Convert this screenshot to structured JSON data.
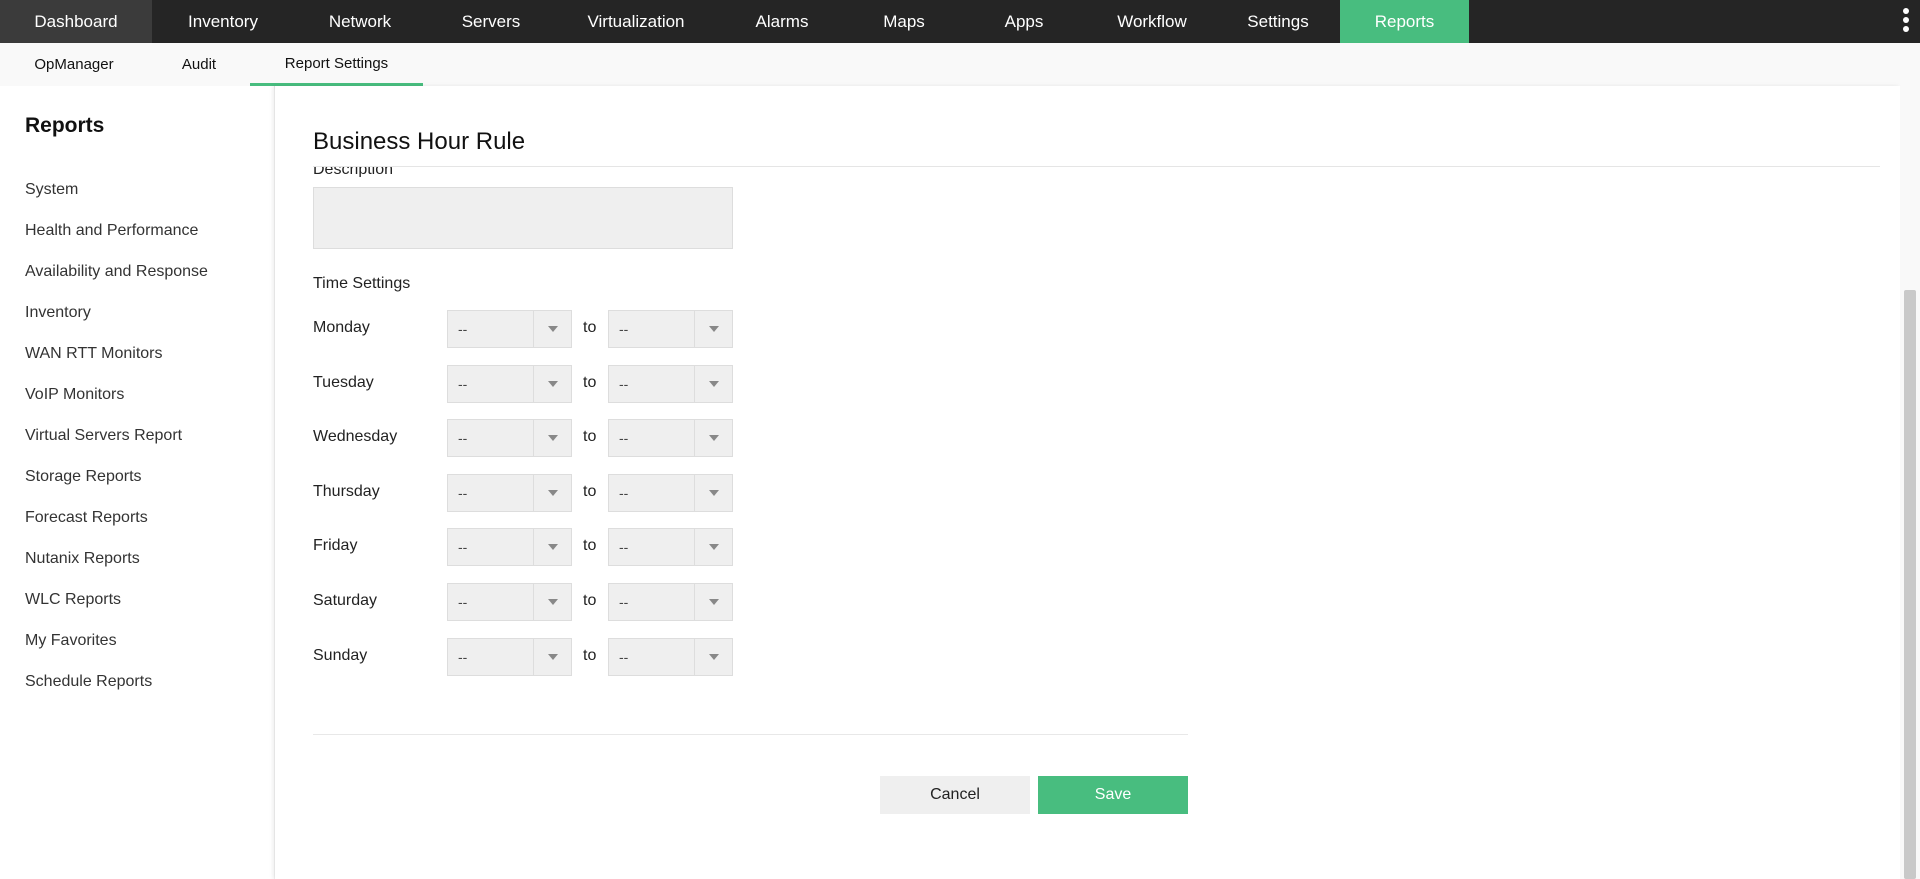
{
  "topnav": {
    "tabs": [
      "Dashboard",
      "Inventory",
      "Network",
      "Servers",
      "Virtualization",
      "Alarms",
      "Maps",
      "Apps",
      "Workflow",
      "Settings",
      "Reports"
    ],
    "active": "Reports",
    "accent": "#48bd7f"
  },
  "subnav": {
    "tabs": [
      "OpManager",
      "Audit",
      "Report Settings"
    ],
    "active": "Report Settings"
  },
  "sidebar": {
    "title": "Reports",
    "items": [
      "System",
      "Health and Performance",
      "Availability and Response",
      "Inventory",
      "WAN RTT Monitors",
      "VoIP Monitors",
      "Virtual Servers Report",
      "Storage Reports",
      "Forecast Reports",
      "Nutanix Reports",
      "WLC Reports",
      "My Favorites",
      "Schedule Reports"
    ]
  },
  "main": {
    "title": "Business Hour Rule",
    "description_label": "Description",
    "description_value": "",
    "time_settings_label": "Time Settings",
    "to_label": "to",
    "days": [
      {
        "day": "Monday",
        "from": "--",
        "to": "--"
      },
      {
        "day": "Tuesday",
        "from": "--",
        "to": "--"
      },
      {
        "day": "Wednesday",
        "from": "--",
        "to": "--"
      },
      {
        "day": "Thursday",
        "from": "--",
        "to": "--"
      },
      {
        "day": "Friday",
        "from": "--",
        "to": "--"
      },
      {
        "day": "Saturday",
        "from": "--",
        "to": "--"
      },
      {
        "day": "Sunday",
        "from": "--",
        "to": "--"
      }
    ],
    "cancel": "Cancel",
    "save": "Save"
  }
}
